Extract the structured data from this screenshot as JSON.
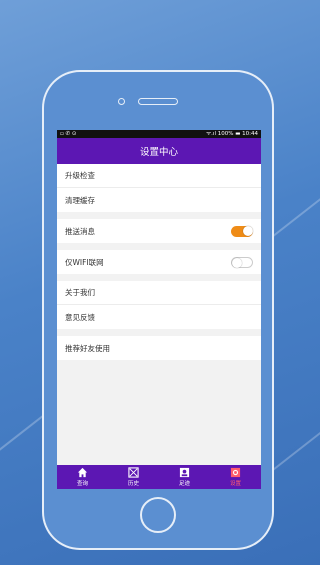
{
  "status_bar": {
    "left": "▫ ✆ ⊙",
    "right": "ᯤ.ıl 100% ▬ 10:44"
  },
  "header": {
    "title": "设置中心"
  },
  "settings": {
    "upgrade_check": "升级检查",
    "clear_cache": "清理缓存",
    "push_messages": "推送消息",
    "push_messages_on": true,
    "wifi_only": "仅WIFI联网",
    "wifi_only_on": false,
    "about_us": "关于我们",
    "feedback": "意见反馈",
    "recommend": "推荐好友使用"
  },
  "tabs": [
    {
      "label": "查询",
      "icon": "home-icon"
    },
    {
      "label": "历史",
      "icon": "history-icon"
    },
    {
      "label": "足迹",
      "icon": "footprint-icon"
    },
    {
      "label": "设置",
      "icon": "settings-icon",
      "active": true
    }
  ],
  "colors": {
    "accent": "#5c17b3",
    "toggle_on": "#ef8c17",
    "active_tab": "#ff5d6e"
  }
}
